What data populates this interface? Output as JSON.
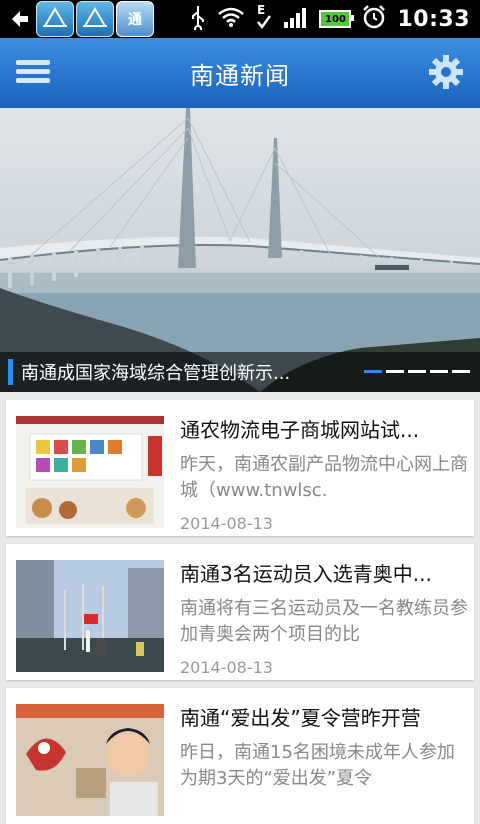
{
  "status_bar": {
    "time": "10:33",
    "battery_level": "100",
    "icons": [
      "back-icon",
      "nantong-app-icon",
      "nantong-app-icon",
      "nantong-app-icon",
      "usb-icon",
      "wifi-icon",
      "signal-e-icon",
      "signal-bars-icon",
      "battery-icon",
      "alarm-icon"
    ],
    "app_icon_label": "通"
  },
  "header": {
    "title": "南通新闻"
  },
  "banner": {
    "caption": "南通成国家海域综合管理创新示...",
    "slide_count": 5,
    "active_slide": 1
  },
  "news": [
    {
      "title": "通农物流电子商城网站试...",
      "summary": "昨天，南通农副产品物流中心网上商城（www.tnwlsc.",
      "date": "2014-08-13"
    },
    {
      "title": "南通3名运动员入选青奥中...",
      "summary": "南通将有三名运动员及一名教练员参加青奥会两个项目的比",
      "date": "2014-08-13"
    },
    {
      "title": "南通“爱出发”夏令营昨开营",
      "summary": "昨日，南通15名困境未成年人参加为期3天的“爱出发”夏令",
      "date": ""
    }
  ],
  "colors": {
    "header_blue": "#1b62bd",
    "accent_blue": "#2d8ee8"
  }
}
